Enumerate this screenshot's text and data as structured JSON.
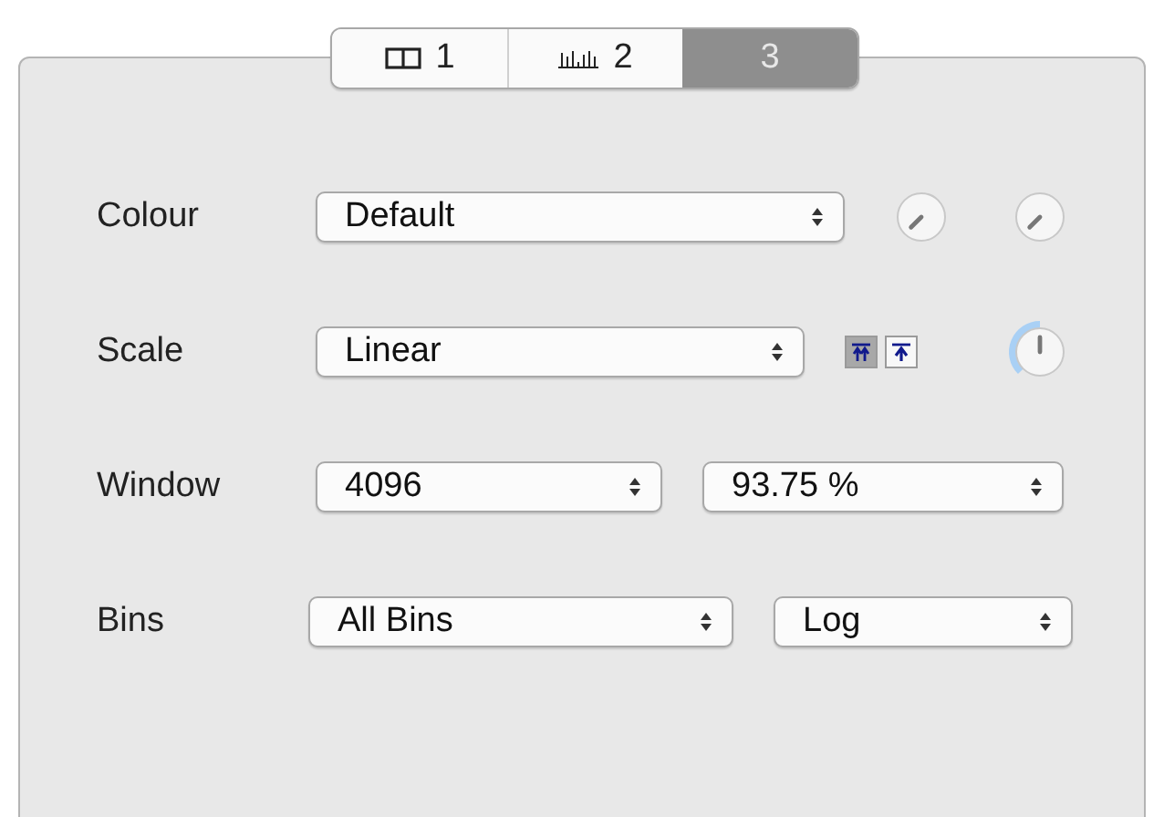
{
  "tabs": [
    {
      "label": "1",
      "selected": false
    },
    {
      "label": "2",
      "selected": false
    },
    {
      "label": "3",
      "selected": true
    }
  ],
  "rows": [
    {
      "label": "Colour",
      "selects": [
        "Default"
      ],
      "extras": [
        {
          "kind": "knob"
        },
        {
          "kind": "knob"
        }
      ]
    },
    {
      "label": "Scale",
      "selects": [
        "Linear"
      ],
      "extras": [
        {
          "kind": "toggles",
          "buttons": [
            {
              "selected": true
            },
            {
              "selected": false
            }
          ]
        },
        {
          "kind": "knob"
        }
      ]
    },
    {
      "label": "Window",
      "selects": [
        "4096",
        "93.75 %"
      ],
      "extras": []
    },
    {
      "label": "Bins",
      "selects": [
        "All Bins",
        "Log"
      ],
      "extras": []
    }
  ]
}
